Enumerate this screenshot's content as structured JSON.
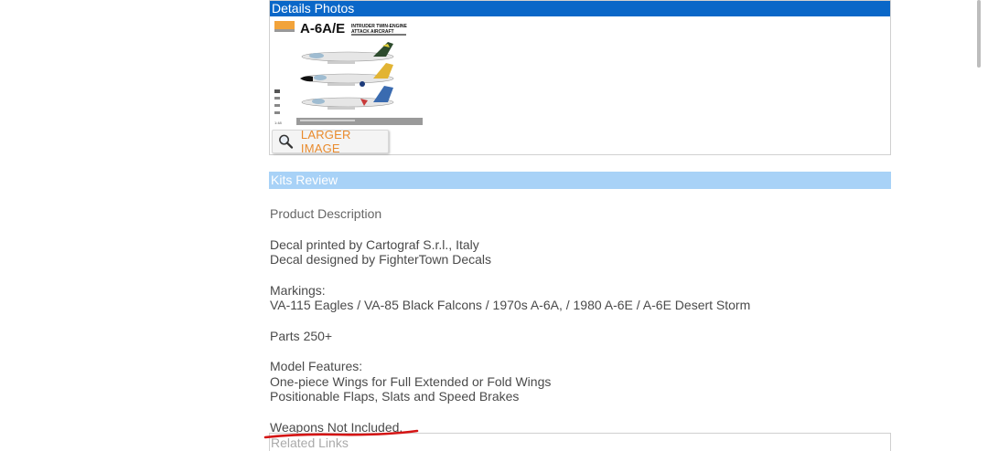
{
  "details": {
    "header": "Details Photos",
    "thumbnail": {
      "title": "A-6A/E",
      "subtitle_1": "INTRUDER TWIN-ENGINE",
      "subtitle_2": "ATTACK AIRCRAFT"
    },
    "larger_image_button": "LARGER IMAGE"
  },
  "review": {
    "header": "Kits Review",
    "product_description_title": "Product Description",
    "decal_line_1": "Decal printed by Cartograf S.r.l., Italy",
    "decal_line_2": "Decal designed by FighterTown Decals",
    "markings_title": "Markings:",
    "markings_text": "VA-115 Eagles / VA-85 Black Falcons / 1970s A-6A, / 1980 A-6E / A-6E Desert Storm",
    "parts": "Parts 250+",
    "features_title": "Model Features:",
    "feature_1": "One-piece Wings for Full Extended or Fold Wings",
    "feature_2": "Positionable Flaps, Slats and Speed Brakes",
    "weapons": "Weapons Not Included."
  },
  "related": {
    "label": "Related Links"
  },
  "colors": {
    "details_header_bg": "#0a67c8",
    "review_header_bg": "#a8d2f7",
    "larger_image_text": "#e98a2c",
    "underline": "#d41414"
  }
}
